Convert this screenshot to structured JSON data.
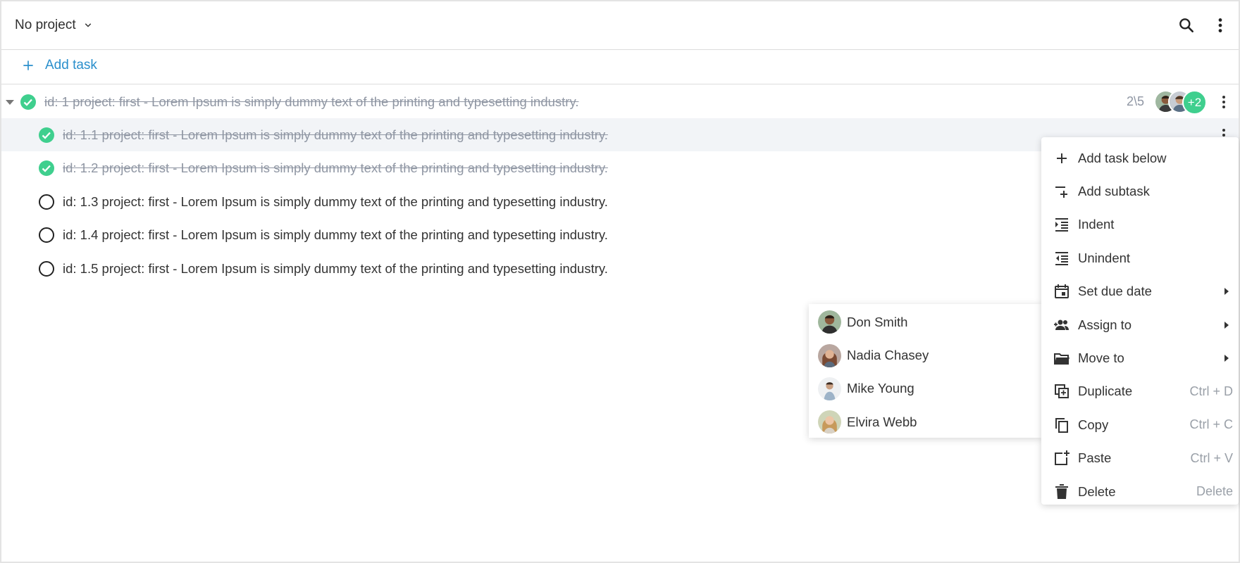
{
  "toolbar": {
    "project_label": "No project",
    "icons": [
      "chevron-down-icon",
      "search-icon",
      "more-vert-icon"
    ]
  },
  "add_task": {
    "label": "Add task",
    "icon": "plus-icon"
  },
  "colors": {
    "accent": "#2a8fcc",
    "done": "#3fcf8e",
    "done_text": "#8f96a3",
    "row_highlight": "#f2f4f7"
  },
  "tasks": [
    {
      "text": "id: 1 project: first - Lorem Ipsum is simply dummy text of the printing and typesetting industry.",
      "done": true,
      "expanded": true,
      "counter": "2\\5",
      "extra_assignees": "+2"
    },
    {
      "text": "id: 1.1 project: first - Lorem Ipsum is simply dummy text of the printing and typesetting industry.",
      "done": true,
      "highlighted": true
    },
    {
      "text": "id: 1.2 project: first - Lorem Ipsum is simply dummy text of the printing and typesetting industry.",
      "done": true
    },
    {
      "text": "id: 1.3 project: first - Lorem Ipsum is simply dummy text of the printing and typesetting industry.",
      "done": false
    },
    {
      "text": "id: 1.4 project: first - Lorem Ipsum is simply dummy text of the printing and typesetting industry.",
      "done": false
    },
    {
      "text": "id: 1.5 project: first - Lorem Ipsum is simply dummy text of the printing and typesetting industry.",
      "done": false
    }
  ],
  "context_menu": [
    {
      "label": "Add task below",
      "icon": "plus-icon",
      "shortcut": ""
    },
    {
      "label": "Add subtask",
      "icon": "add-subtask-icon",
      "shortcut": ""
    },
    {
      "label": "Indent",
      "icon": "indent-icon",
      "shortcut": ""
    },
    {
      "label": "Unindent",
      "icon": "unindent-icon",
      "shortcut": ""
    },
    {
      "label": "Set due date",
      "icon": "calendar-icon",
      "shortcut": "",
      "submenu": true
    },
    {
      "label": "Assign to",
      "icon": "assign-people-icon",
      "shortcut": "",
      "submenu": true
    },
    {
      "label": "Move to",
      "icon": "folder-icon",
      "shortcut": "",
      "submenu": true
    },
    {
      "label": "Duplicate",
      "icon": "duplicate-icon",
      "shortcut": "Ctrl + D"
    },
    {
      "label": "Copy",
      "icon": "copy-icon",
      "shortcut": "Ctrl + C"
    },
    {
      "label": "Paste",
      "icon": "paste-icon",
      "shortcut": "Ctrl + V"
    },
    {
      "label": "Delete",
      "icon": "trash-icon",
      "shortcut": "Delete"
    }
  ],
  "assign_submenu": [
    {
      "name": "Don Smith",
      "avatar": "avatar-don-smith"
    },
    {
      "name": "Nadia Chasey",
      "avatar": "avatar-nadia-chasey"
    },
    {
      "name": "Mike Young",
      "avatar": "avatar-mike-young"
    },
    {
      "name": "Elvira Webb",
      "avatar": "avatar-elvira-webb"
    }
  ]
}
